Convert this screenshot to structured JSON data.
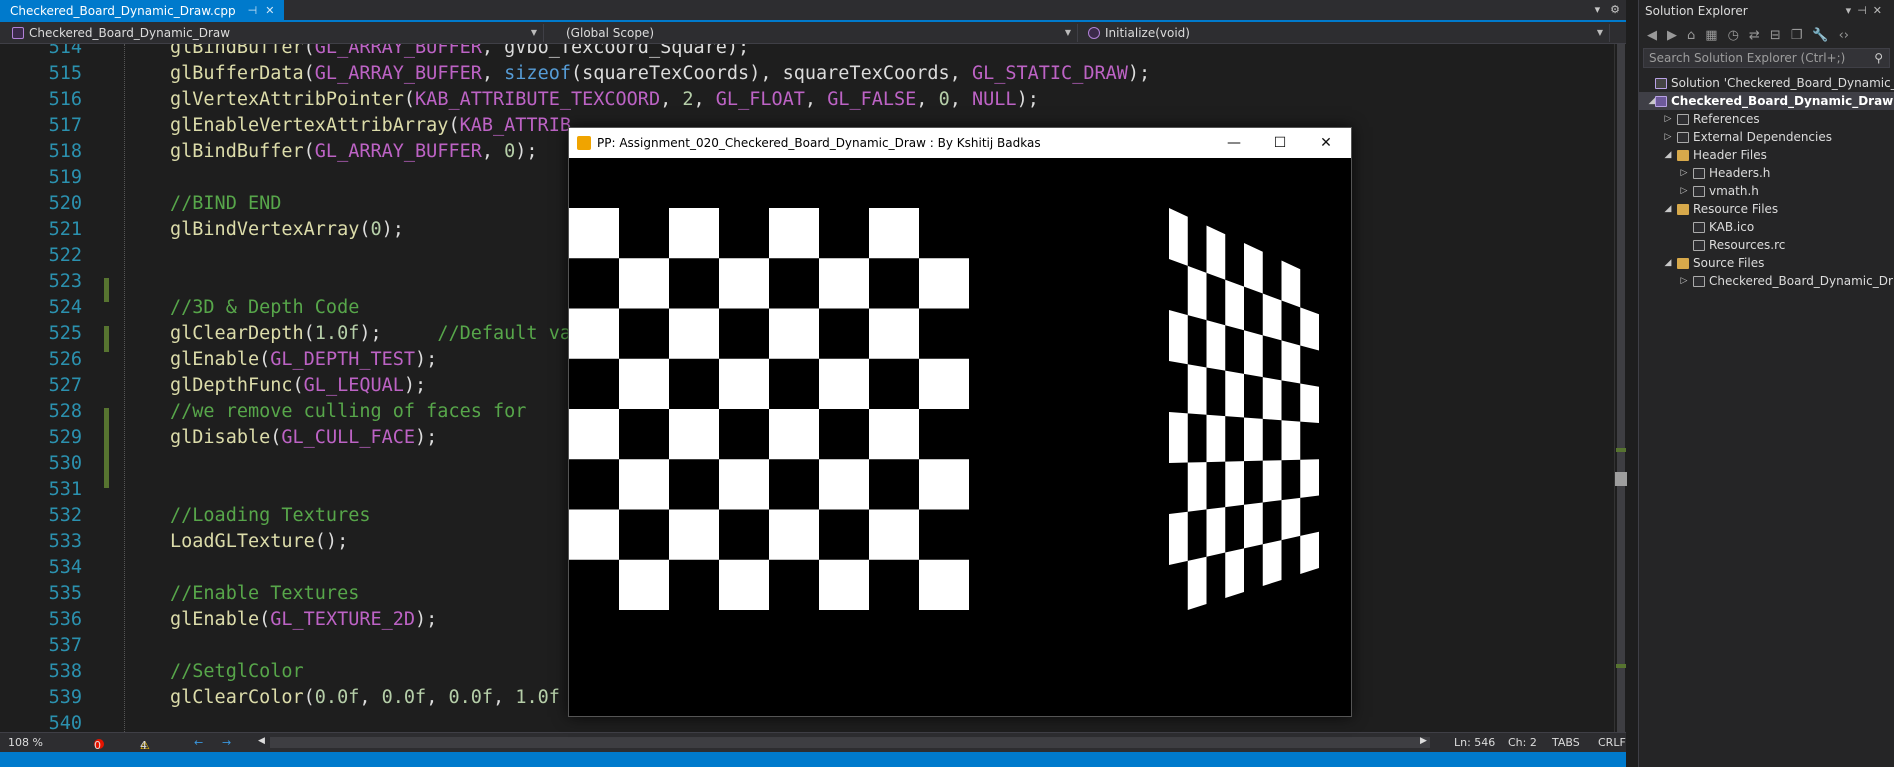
{
  "editor_tab": {
    "filename": "Checkered_Board_Dynamic_Draw.cpp",
    "pin_icon": "pin-icon",
    "close_icon": "close-icon"
  },
  "navbar": {
    "project": "Checkered_Board_Dynamic_Draw",
    "scope": "(Global Scope)",
    "member": "Initialize(void)"
  },
  "code_lines": [
    {
      "n": "514",
      "text": "glBindBuffer(GL_ARRAY_BUFFER, gVbo_Texcoord_Square);"
    },
    {
      "n": "515",
      "text": "glBufferData(GL_ARRAY_BUFFER, sizeof(squareTexCoords), squareTexCoords, GL_STATIC_DRAW);"
    },
    {
      "n": "516",
      "text": "glVertexAttribPointer(KAB_ATTRIBUTE_TEXCOORD, 2, GL_FLOAT, GL_FALSE, 0, NULL);"
    },
    {
      "n": "517",
      "text": "glEnableVertexAttribArray(KAB_ATTRIB"
    },
    {
      "n": "518",
      "text": "glBindBuffer(GL_ARRAY_BUFFER, 0);"
    },
    {
      "n": "519",
      "text": ""
    },
    {
      "n": "520",
      "text": "//BIND END"
    },
    {
      "n": "521",
      "text": "glBindVertexArray(0);"
    },
    {
      "n": "522",
      "text": ""
    },
    {
      "n": "523",
      "text": ""
    },
    {
      "n": "524",
      "text": "//3D & Depth Code"
    },
    {
      "n": "525",
      "text": "glClearDepth(1.0f);     //Default va"
    },
    {
      "n": "526",
      "text": "glEnable(GL_DEPTH_TEST);"
    },
    {
      "n": "527",
      "text": "glDepthFunc(GL_LEQUAL);"
    },
    {
      "n": "528",
      "text": "//we remove culling of faces for"
    },
    {
      "n": "529",
      "text": "glDisable(GL_CULL_FACE);"
    },
    {
      "n": "530",
      "text": ""
    },
    {
      "n": "531",
      "text": ""
    },
    {
      "n": "532",
      "text": "//Loading Textures"
    },
    {
      "n": "533",
      "text": "LoadGLTexture();"
    },
    {
      "n": "534",
      "text": ""
    },
    {
      "n": "535",
      "text": "//Enable Textures"
    },
    {
      "n": "536",
      "text": "glEnable(GL_TEXTURE_2D);"
    },
    {
      "n": "537",
      "text": ""
    },
    {
      "n": "538",
      "text": "//SetglColor"
    },
    {
      "n": "539",
      "text": "glClearColor(0.0f, 0.0f, 0.0f, 1.0f"
    },
    {
      "n": "540",
      "text": ""
    }
  ],
  "status": {
    "zoom": "108 %",
    "errors": "0",
    "warnings": "4",
    "line": "Ln: 546",
    "col": "Ch: 2",
    "tabs": "TABS",
    "eol": "CRLF"
  },
  "gl_window": {
    "title": "PP: Assignment_020_Checkered_Board_Dynamic_Draw : By Kshitij Badkas",
    "minimize": "—",
    "maximize": "☐",
    "close": "✕"
  },
  "solution_explorer": {
    "title": "Solution Explorer",
    "search_placeholder": "Search Solution Explorer (Ctrl+;)",
    "items": [
      {
        "label": "Solution 'Checkered_Board_Dynamic_Dra",
        "icon": "solution-icon",
        "level": 0,
        "arrow": ""
      },
      {
        "label": "Checkered_Board_Dynamic_Draw",
        "icon": "project-icon",
        "level": 0,
        "arrow": "◢",
        "selected": true
      },
      {
        "label": "References",
        "icon": "references-icon",
        "level": 1,
        "arrow": "▷"
      },
      {
        "label": "External Dependencies",
        "icon": "dependencies-icon",
        "level": 1,
        "arrow": "▷"
      },
      {
        "label": "Header Files",
        "icon": "folder-icon",
        "level": 1,
        "arrow": "◢"
      },
      {
        "label": "Headers.h",
        "icon": "header-file-icon",
        "level": 2,
        "arrow": "▷"
      },
      {
        "label": "vmath.h",
        "icon": "header-file-icon",
        "level": 2,
        "arrow": "▷"
      },
      {
        "label": "Resource Files",
        "icon": "folder-icon",
        "level": 1,
        "arrow": "◢"
      },
      {
        "label": "KAB.ico",
        "icon": "icon-file-icon",
        "level": 2,
        "arrow": ""
      },
      {
        "label": "Resources.rc",
        "icon": "resource-file-icon",
        "level": 2,
        "arrow": ""
      },
      {
        "label": "Source Files",
        "icon": "folder-icon",
        "level": 1,
        "arrow": "◢"
      },
      {
        "label": "Checkered_Board_Dynamic_Dr",
        "icon": "cpp-file-icon",
        "level": 2,
        "arrow": "▷"
      }
    ]
  },
  "colors": {
    "accent": "#007acc",
    "change_bar": "#577430",
    "editor_bg": "#1e1e1e"
  }
}
